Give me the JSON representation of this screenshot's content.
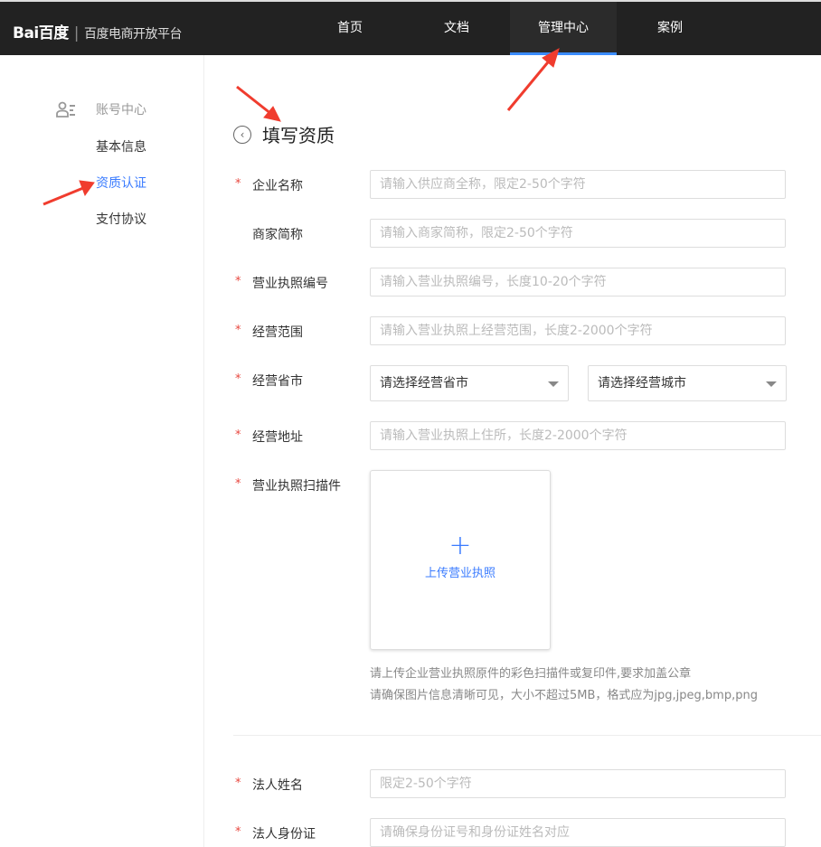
{
  "header": {
    "logo": "Bai百度",
    "platform": "百度电商开放平台",
    "nav": [
      "首页",
      "文档",
      "管理中心",
      "案例"
    ],
    "active_nav": 2
  },
  "sidebar": {
    "section": "账号中心",
    "items": [
      "基本信息",
      "资质认证",
      "支付协议"
    ],
    "active": 1
  },
  "page": {
    "title": "填写资质"
  },
  "form": {
    "company_name": {
      "label": "企业名称",
      "placeholder": "请输入供应商全称，限定2-50个字符"
    },
    "short_name": {
      "label": "商家简称",
      "placeholder": "请输入商家简称，限定2-50个字符"
    },
    "license_no": {
      "label": "营业执照编号",
      "placeholder": "请输入营业执照编号，长度10-20个字符"
    },
    "scope": {
      "label": "经营范围",
      "placeholder": "请输入营业执照上经营范围，长度2-2000个字符"
    },
    "region": {
      "label": "经营省市",
      "province": "请选择经营省市",
      "city": "请选择经营城市"
    },
    "address": {
      "label": "经营地址",
      "placeholder": "请输入营业执照上住所，长度2-2000个字符"
    },
    "scan": {
      "label": "营业执照扫描件",
      "upload": "上传营业执照",
      "hint1": "请上传企业营业执照原件的彩色扫描件或复印件,要求加盖公章",
      "hint2": "请确保图片信息清晰可见，大小不超过5MB，格式应为jpg,jpeg,bmp,png"
    },
    "legal_name": {
      "label": "法人姓名",
      "placeholder": "限定2-50个字符"
    },
    "legal_id": {
      "label": "法人身份证",
      "placeholder": "请确保身份证号和身份证姓名对应"
    }
  }
}
